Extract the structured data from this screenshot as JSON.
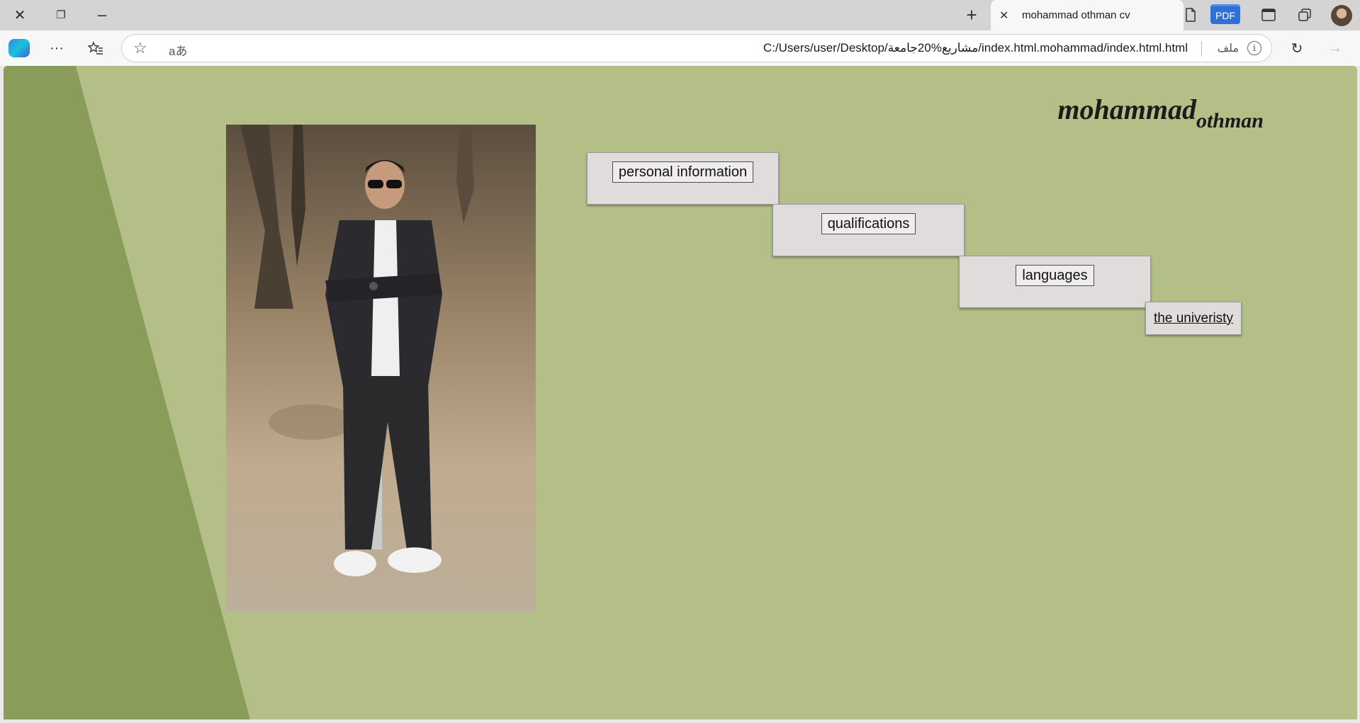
{
  "browser": {
    "tab_title": "mohammad othman cv",
    "url": "C:/Users/user/Desktop/مشاريع%20جامعة/index.html.mohammad/index.html.html",
    "file_label": "ملف",
    "read_aloud_label": "aあ",
    "pdf_label": "PDF",
    "new_tab_glyph": "+",
    "close_glyph": "✕"
  },
  "page": {
    "name_main": "mohammad",
    "name_sub": "othman",
    "menu": {
      "personal_information": "personal information",
      "qualifications": "qualifications",
      "languages": "languages",
      "university": "the univeristy"
    },
    "colors": {
      "background": "#b4bf88",
      "stripe": "#8a9c5a",
      "box": "#e0dcdc"
    }
  }
}
